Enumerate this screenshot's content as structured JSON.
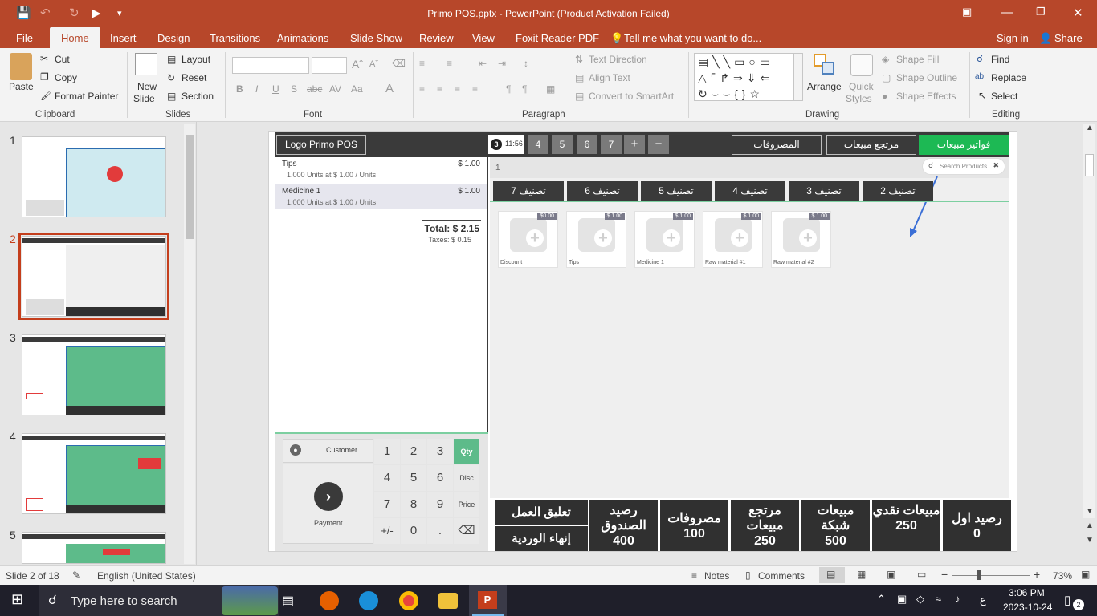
{
  "app": {
    "title": "Primo POS.pptx - PowerPoint (Product Activation Failed)",
    "window_controls": [
      "ribbon-display",
      "minimize",
      "restore",
      "close"
    ]
  },
  "menu": {
    "tabs": [
      "File",
      "Home",
      "Insert",
      "Design",
      "Transitions",
      "Animations",
      "Slide Show",
      "Review",
      "View",
      "Foxit Reader PDF"
    ],
    "tell_me": "Tell me what you want to do...",
    "sign_in": "Sign in",
    "share": "Share"
  },
  "ribbon": {
    "clipboard": {
      "paste": "Paste",
      "cut": "Cut",
      "copy": "Copy",
      "format_painter": "Format Painter",
      "group": "Clipboard"
    },
    "slides": {
      "new_slide_1": "New",
      "new_slide_2": "Slide",
      "layout": "Layout",
      "reset": "Reset",
      "section": "Section",
      "group": "Slides"
    },
    "font": {
      "group": "Font"
    },
    "paragraph": {
      "text_direction": "Text Direction",
      "align_text": "Align Text",
      "convert_smartart": "Convert to SmartArt",
      "group": "Paragraph"
    },
    "drawing": {
      "arrange": "Arrange",
      "quick_styles_1": "Quick",
      "quick_styles_2": "Styles",
      "shape_fill": "Shape Fill",
      "shape_outline": "Shape Outline",
      "shape_effects": "Shape Effects",
      "group": "Drawing"
    },
    "editing": {
      "find": "Find",
      "replace": "Replace",
      "select": "Select",
      "group": "Editing"
    }
  },
  "thumbnails": [
    "1",
    "2",
    "3",
    "4",
    "5"
  ],
  "slide": {
    "logo": "Logo Primo POS",
    "tab_active_num": "3",
    "tab_time": "11:56",
    "tab_nums": [
      "4",
      "5",
      "6",
      "7"
    ],
    "tab_plus": "+",
    "tab_minus": "−",
    "btn_expenses": "المصروفات",
    "btn_returns": "مرتجع مبيعات",
    "btn_invoices": "فواتير مبيعات",
    "order_num": "1",
    "search_placeholder": "Search Products",
    "categories": [
      "تصنيف 7",
      "تصنيف 6",
      "تصنيف 5",
      "تصنيف 4",
      "تصنيف 3",
      "تصنيف 2"
    ],
    "products": [
      {
        "name": "Discount",
        "price": "$0.00"
      },
      {
        "name": "Tips",
        "price": "$ 1.00"
      },
      {
        "name": "Medicine 1",
        "price": "$ 1.00"
      },
      {
        "name": "Raw material #1",
        "price": "$ 1.00"
      },
      {
        "name": "Raw material #2",
        "price": "$ 1.00"
      }
    ],
    "order_lines": [
      {
        "name": "Tips",
        "detail": "1.000 Units at $ 1.00 / Units",
        "price": "$ 1.00"
      },
      {
        "name": "Medicine 1",
        "detail": "1.000 Units at $ 1.00 / Units",
        "price": "$ 1.00"
      }
    ],
    "total": "Total: $ 2.15",
    "taxes": "Taxes: $ 0.15",
    "customer": "Customer",
    "payment": "Payment",
    "keypad": [
      "1",
      "2",
      "3",
      "Qty",
      "4",
      "5",
      "6",
      "Disc",
      "7",
      "8",
      "9",
      "Price",
      "+/-",
      "0",
      ".",
      "⌫"
    ],
    "suspend": "تعليق العمل",
    "end_shift": "إنهاء الوردية",
    "summary": [
      {
        "label": "رصيد الصندوق",
        "value": "400"
      },
      {
        "label": "مصروفات",
        "value": "100"
      },
      {
        "label": "مرتجع مبيعات",
        "value": "250"
      },
      {
        "label": "مبيعات شبكة",
        "value": "500"
      },
      {
        "label": "مبيعات نقدي",
        "value": "250"
      },
      {
        "label": "رصيد اول",
        "value": "0"
      }
    ]
  },
  "status": {
    "slide_of": "Slide 2 of 18",
    "language": "English (United States)",
    "notes": "Notes",
    "comments": "Comments",
    "zoom": "73%"
  },
  "taskbar": {
    "search_placeholder": "Type here to search",
    "time": "3:06 PM",
    "date": "2023-10-24",
    "lang": "ع",
    "notif_count": "2"
  },
  "colors": {
    "accent": "#b7472a",
    "pos_dark": "#3a3a3a",
    "pos_green": "#1db954",
    "slide_bg": "#efefef"
  }
}
